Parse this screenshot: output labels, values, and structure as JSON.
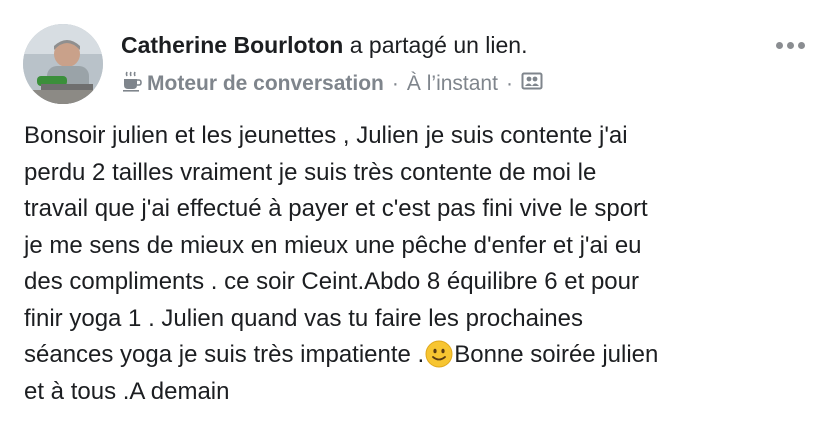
{
  "post": {
    "author": "Catherine Bourloton",
    "action": "a partagé un lien.",
    "group": "Moteur de conversation",
    "separator": "·",
    "time": "À l’instant",
    "group_icon": "coffee-cup-icon",
    "privacy_icon": "group-audience-icon",
    "more_icon": "more-options-icon",
    "text_part1": "Bonsoir julien et les jeunettes , Julien je suis contente j'ai\nperdu 2 tailles vraiment je suis très contente de moi le\ntravail que j'ai effectué à payer et c'est pas fini vive le sport\nje me sens de mieux en mieux une pêche d'enfer et j'ai eu\ndes compliments . ce soir Ceint.Abdo 8 équilibre 6 et pour\nfinir yoga 1 . Julien quand vas tu faire les prochaines\nséances yoga je suis très impatiente .",
    "emoji": "slightly-smiling-face-emoji",
    "text_part2": "Bonne soirée julien\net à tous .A demain"
  },
  "colors": {
    "text": "#1c1e21",
    "secondary": "#7f858c",
    "background": "#ffffff"
  }
}
